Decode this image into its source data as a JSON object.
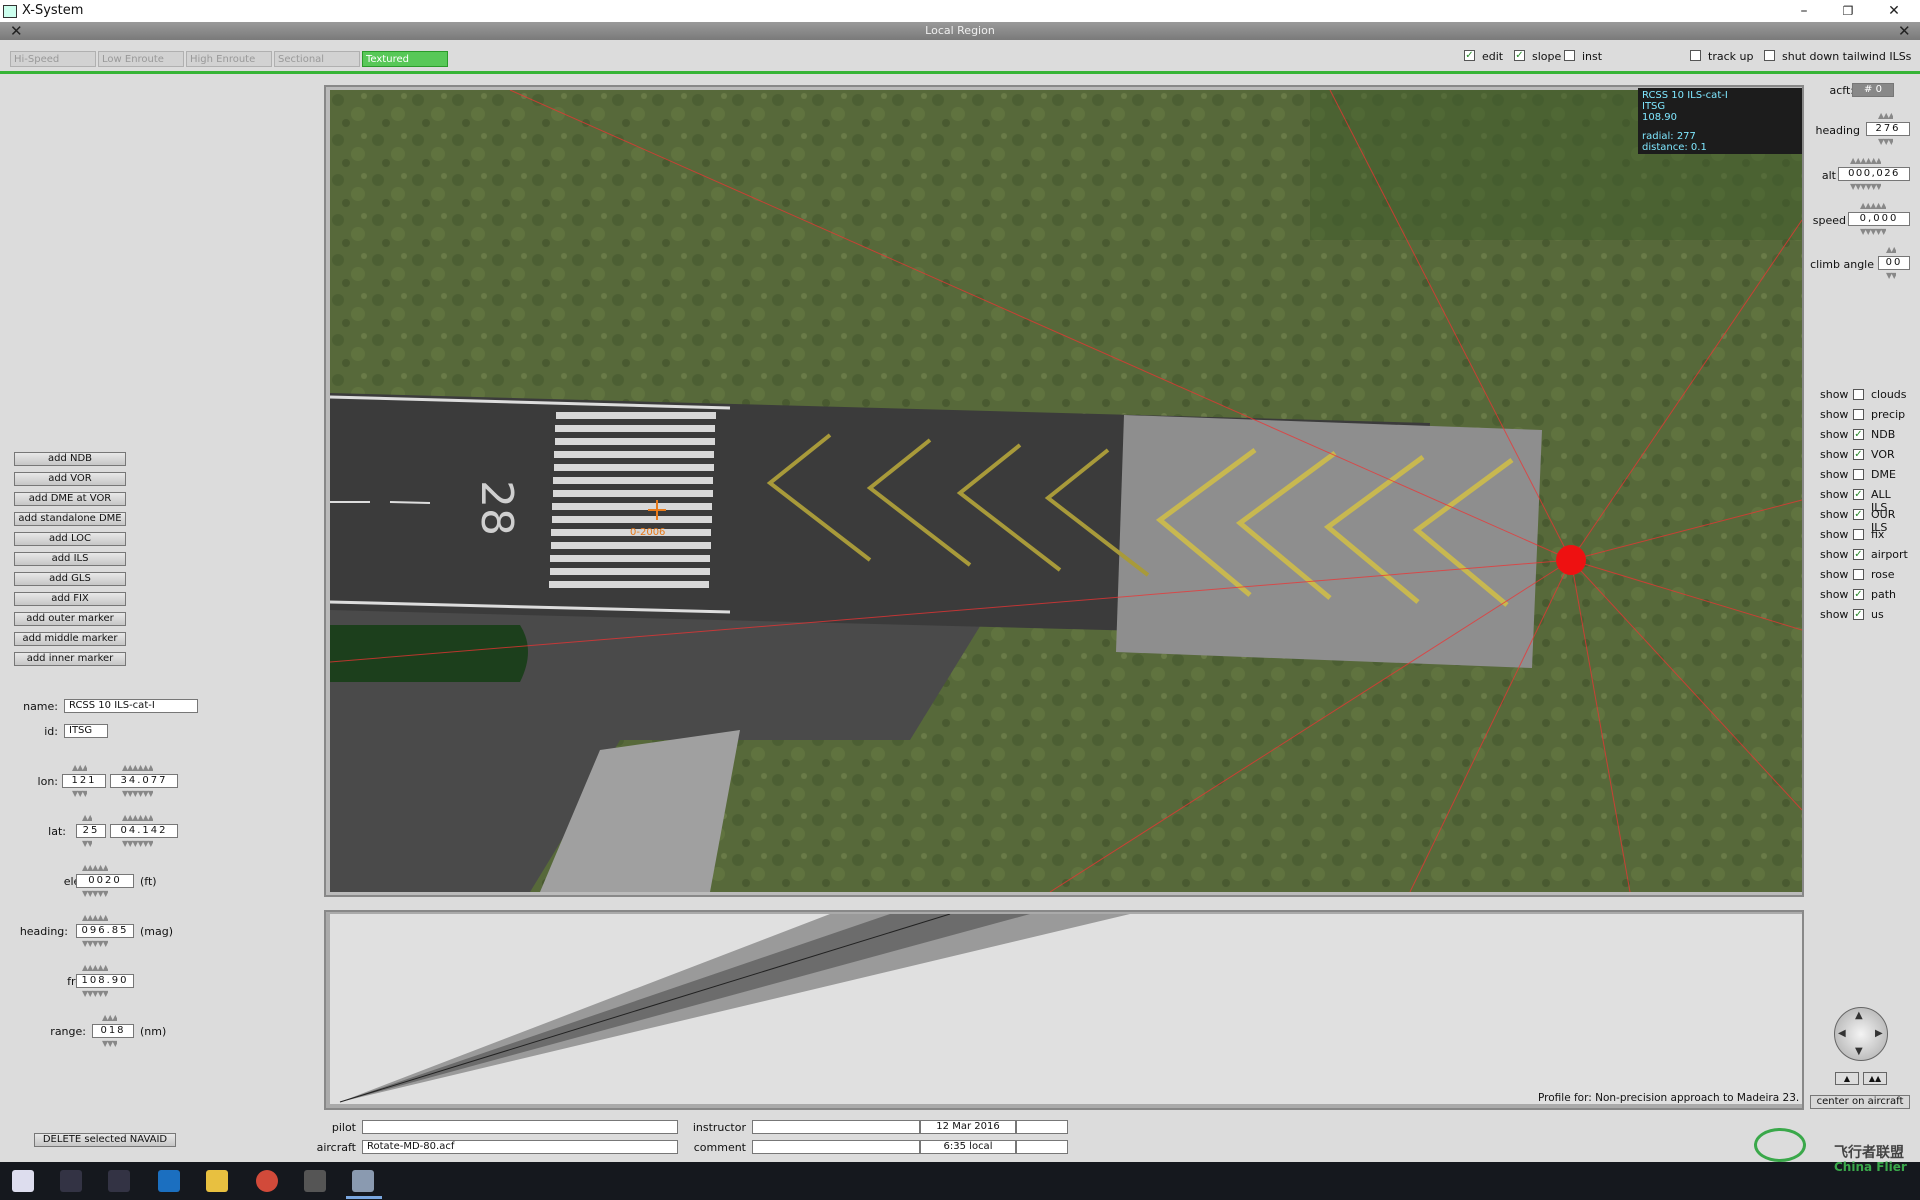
{
  "window": {
    "title": "X-System",
    "minimize": "–",
    "maximize": "❐",
    "close": "✕"
  },
  "region": {
    "title": "Local Region",
    "close": "✕"
  },
  "tabs": [
    {
      "label": "Hi-Speed",
      "active": false
    },
    {
      "label": "Low Enroute",
      "active": false
    },
    {
      "label": "High Enroute",
      "active": false
    },
    {
      "label": "Sectional",
      "active": false
    },
    {
      "label": "Textured",
      "active": true
    }
  ],
  "toggles": {
    "edit": {
      "label": "edit",
      "checked": true
    },
    "slope": {
      "label": "slope",
      "checked": true
    },
    "inst": {
      "label": "inst",
      "checked": false
    },
    "track_up": {
      "label": "track up",
      "checked": false
    },
    "shut_down": {
      "label": "shut down tailwind ILSs",
      "checked": false
    }
  },
  "nav_buttons": [
    "add NDB",
    "add VOR",
    "add DME at VOR",
    "add standalone DME",
    "add LOC",
    "add ILS",
    "add GLS",
    "add FIX",
    "add outer marker",
    "add middle marker",
    "add inner marker"
  ],
  "navaid": {
    "name_label": "name:",
    "name": "RCSS 10  ILS-cat-I",
    "id_label": "id:",
    "id": "ITSG",
    "lon_label": "lon:",
    "lon_deg": "121",
    "lon_min": "34.077",
    "lat_label": "lat:",
    "lat_deg": "25",
    "lat_min": "04.142",
    "ele_label": "ele:",
    "ele": "0020",
    "ele_unit": "(ft)",
    "heading_label": "heading:",
    "heading": "096.85",
    "heading_unit": "(mag)",
    "frq_label": "frq:",
    "frq": "108.90",
    "range_label": "range:",
    "range": "018",
    "range_unit": "(nm)"
  },
  "delete_button": "DELETE selected NAVAID",
  "map_info": {
    "line1": "RCSS 10  ILS-cat-I",
    "line2": "ITSG",
    "line3": "108.90",
    "line4": "radial: 277",
    "line5": "distance: 0.1"
  },
  "runway_number": "28",
  "aircraft_tag": "0-2006",
  "profile_label": "Profile for: Non-precision approach to Madeira 23.",
  "acft": {
    "acft_label": "acft:",
    "acft_value": "# 0",
    "heading_label": "heading",
    "heading": "276",
    "alt_label": "alt",
    "alt": "000,026",
    "speed_label": "speed",
    "speed": "0,000",
    "climb_label": "climb angle",
    "climb": "00"
  },
  "show_label": "show",
  "show_items": [
    {
      "label": "clouds",
      "checked": false
    },
    {
      "label": "precip",
      "checked": false
    },
    {
      "label": "NDB",
      "checked": true
    },
    {
      "label": "VOR",
      "checked": true
    },
    {
      "label": "DME",
      "checked": false
    },
    {
      "label": "ALL ILS",
      "checked": true
    },
    {
      "label": "OUR ILS",
      "checked": true
    },
    {
      "label": "fix",
      "checked": false
    },
    {
      "label": "airport",
      "checked": true
    },
    {
      "label": "rose",
      "checked": false
    },
    {
      "label": "path",
      "checked": true
    },
    {
      "label": "us",
      "checked": true
    }
  ],
  "center_button": "center on aircraft",
  "bottom": {
    "pilot_label": "pilot",
    "pilot": "",
    "aircraft_label": "aircraft",
    "aircraft": "Rotate-MD-80.acf",
    "instructor_label": "instructor",
    "instructor": "",
    "comment_label": "comment",
    "comment": "",
    "date": "12 Mar 2016",
    "time": "6:35 local"
  },
  "watermark": {
    "cn": "飞行者联盟",
    "en": "China Flier"
  },
  "colors": {
    "accent": "#36b436",
    "infobox_text": "#7fe7ff",
    "ils_dot": "#ee1111"
  }
}
